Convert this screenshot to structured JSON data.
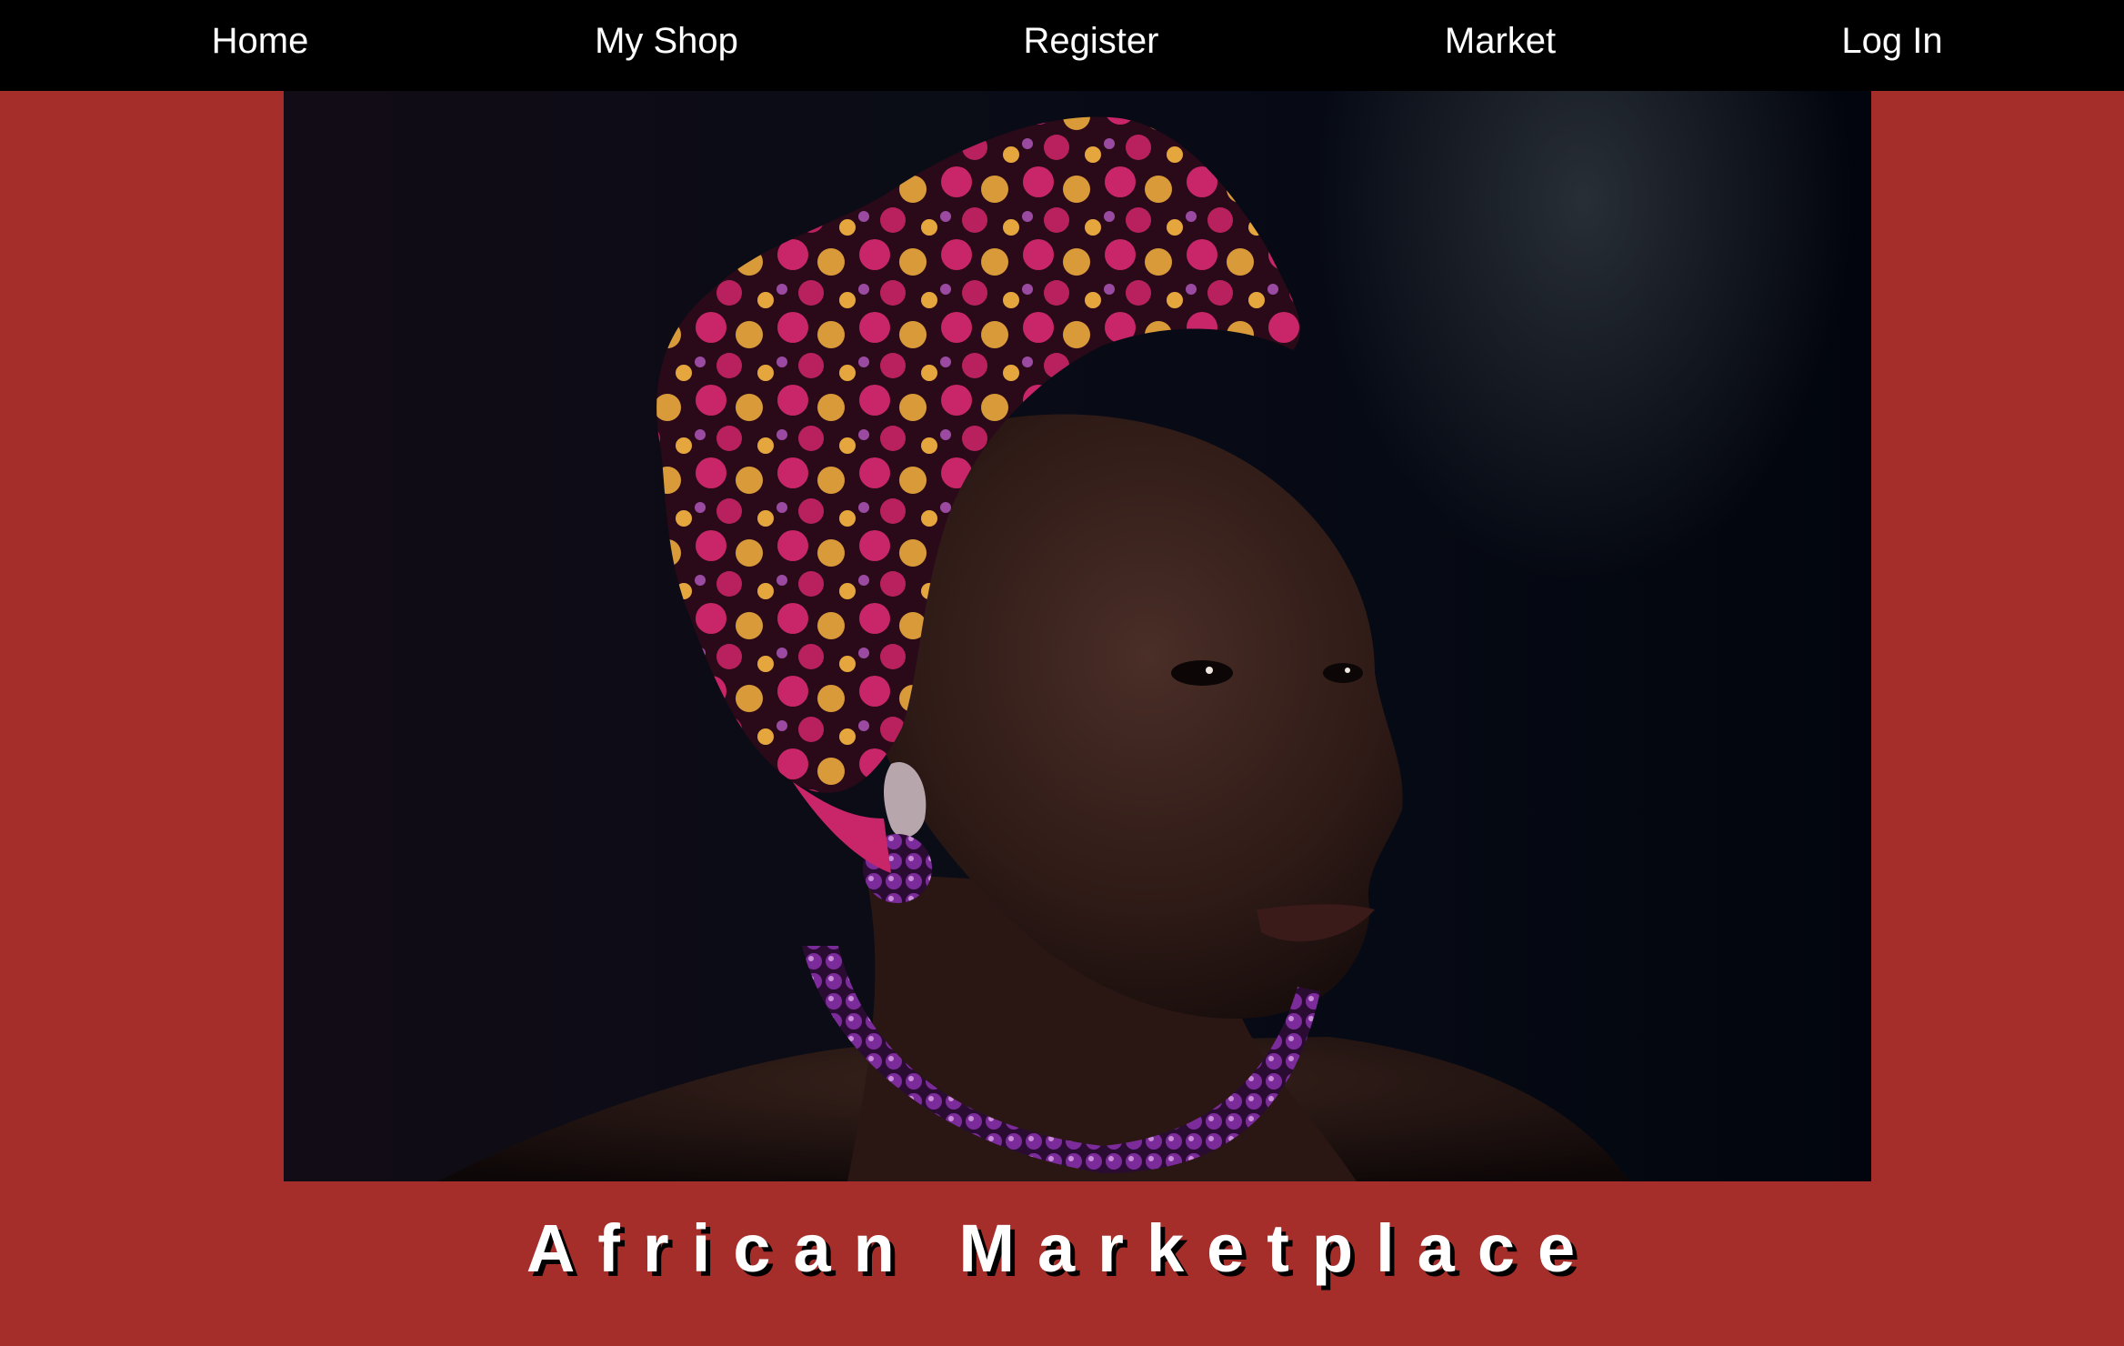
{
  "nav": {
    "items": [
      {
        "label": "Home"
      },
      {
        "label": "My Shop"
      },
      {
        "label": "Register"
      },
      {
        "label": "Market"
      },
      {
        "label": "Log In"
      }
    ]
  },
  "hero": {
    "subject": "portrait of a woman wearing a pink and gold patterned headwrap, purple earring and beaded necklace against a dark background"
  },
  "title": "African Marketplace",
  "colors": {
    "page_background": "#a52d2a",
    "nav_background": "#000000",
    "nav_text": "#ffffff",
    "title_text": "#ffffff",
    "title_shadow": "#000000"
  }
}
